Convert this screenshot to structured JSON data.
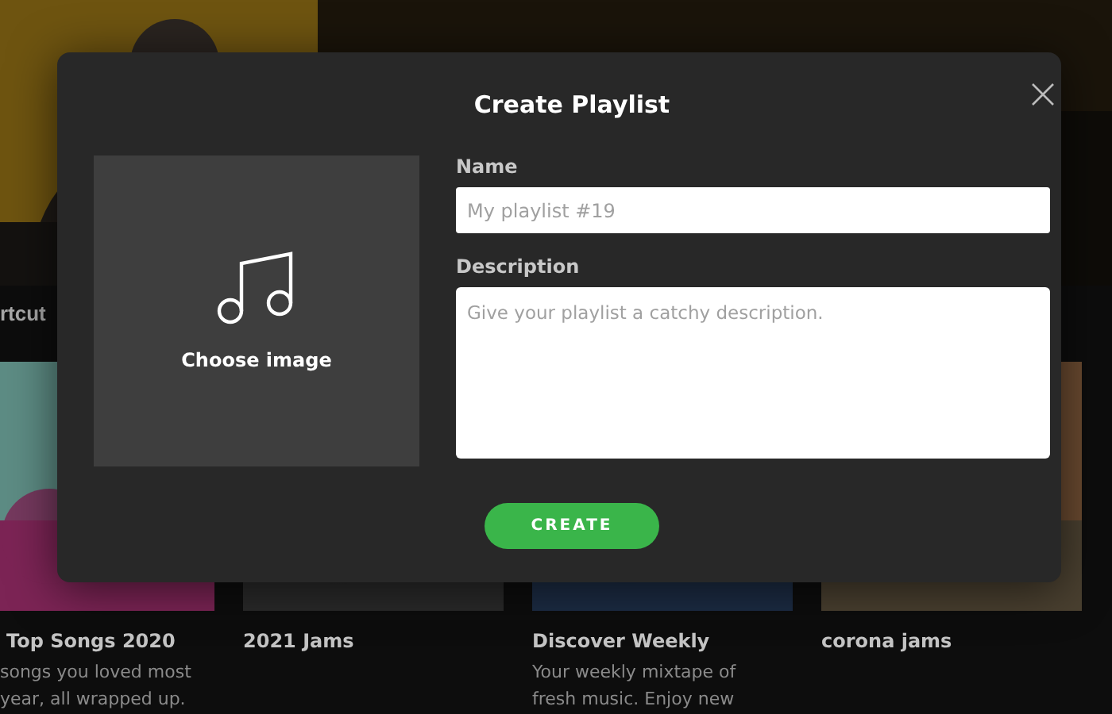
{
  "background": {
    "section_heading": "rtcut",
    "cards": [
      {
        "title": "Top Songs 2020",
        "description": [
          "songs you loved most",
          "year, all wrapped up."
        ]
      },
      {
        "title": "2021 Jams"
      },
      {
        "title": "Discover Weekly",
        "description": [
          "Your weekly mixtape of",
          "fresh music. Enjoy new"
        ]
      },
      {
        "title": "corona jams"
      }
    ]
  },
  "dialog": {
    "title": "Create Playlist",
    "image_label": "Choose image",
    "fields": [
      {
        "label": "Name",
        "placeholder": "My playlist #19",
        "kind": "input"
      },
      {
        "label": "Description",
        "placeholder": "Give your playlist a catchy description.",
        "kind": "textarea"
      }
    ],
    "button": "CREATE"
  }
}
